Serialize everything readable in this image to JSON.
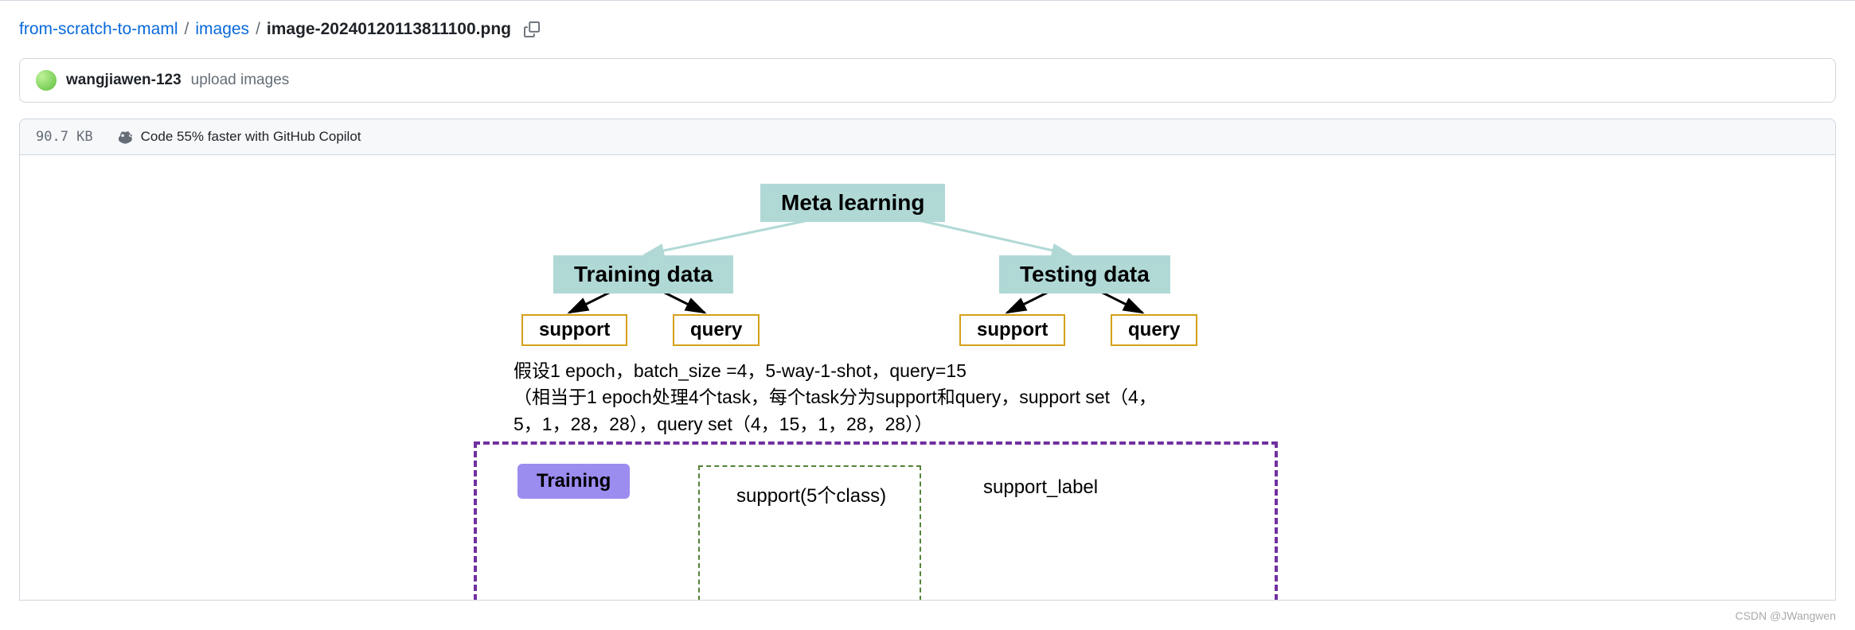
{
  "breadcrumb": {
    "repo": "from-scratch-to-maml",
    "folder": "images",
    "file": "image-20240120113811100.png"
  },
  "commit": {
    "author": "wangjiawen-123",
    "message": "upload images"
  },
  "fileInfo": {
    "size": "90.7 KB",
    "copilot": "Code 55% faster with GitHub Copilot"
  },
  "diagram": {
    "root": "Meta learning",
    "left": "Training data",
    "right": "Testing data",
    "child_support": "support",
    "child_query": "query",
    "desc_line1": "假设1 epoch，batch_size =4，5-way-1-shot，query=15",
    "desc_line2": "（相当于1 epoch处理4个task，每个task分为support和query，support set（4，",
    "desc_line3": "5，1，28，28），query set（4，15，1，28，28））",
    "training_badge": "Training",
    "support_box": "support(5个class)",
    "support_label": "support_label"
  },
  "watermark": "CSDN @JWangwen"
}
